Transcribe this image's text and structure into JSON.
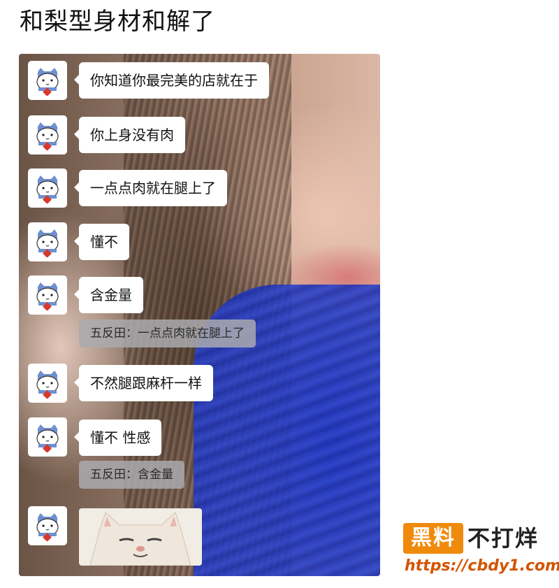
{
  "post": {
    "title": "和梨型身材和解了"
  },
  "chat": {
    "messages": [
      {
        "type": "text",
        "text": "你知道你最完美的店就在于"
      },
      {
        "type": "text",
        "text": "你上身没有肉"
      },
      {
        "type": "text",
        "text": "一点点肉就在腿上了"
      },
      {
        "type": "text",
        "text": "懂不"
      },
      {
        "type": "text",
        "text": "含金量",
        "quote": "五反田：一点点肉就在腿上了"
      },
      {
        "type": "text",
        "text": "不然腿跟麻杆一样"
      },
      {
        "type": "text",
        "text": "懂不 性感",
        "quote": "五反田：含金量"
      },
      {
        "type": "sticker",
        "icon": "cat-sticker"
      }
    ],
    "avatar_icon": "cat-avatar-icon"
  },
  "watermark": {
    "badge": "黑料",
    "slogan": "不打烊",
    "url": "https://cbdy1.com",
    "accent_color": "#f08a0c"
  }
}
